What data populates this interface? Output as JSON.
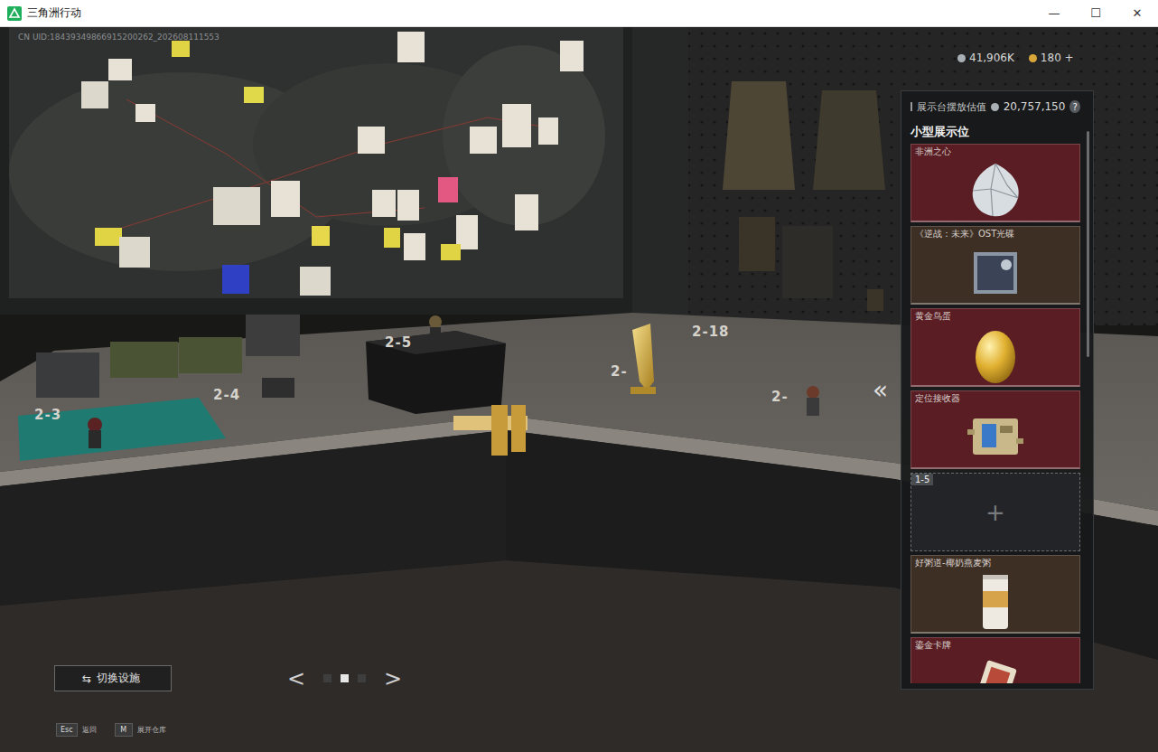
{
  "window": {
    "title": "三角洲行动",
    "controls": [
      "—",
      "☐",
      "✕"
    ]
  },
  "uid": "CN UID:18439349866915200262_202608111553",
  "currencies": [
    {
      "amount": "41,906K",
      "color": "#a9b0b5"
    },
    {
      "amount": "180 +",
      "color": "#d9a63a"
    }
  ],
  "desk_labels": [
    "2-3",
    "2-4",
    "2-5",
    "2-18",
    "2-",
    "2-"
  ],
  "display_panel": {
    "title": "展示台摆放估值",
    "value": "20,757,150",
    "help": "?",
    "section": "小型展示位",
    "slots": [
      {
        "kind": "item",
        "name": "非洲之心",
        "color": "#5a1d23"
      },
      {
        "kind": "item",
        "name": "《逆战：未来》OST光碟",
        "color": "#3d2f24"
      },
      {
        "kind": "item",
        "name": "黄金鸟蛋",
        "color": "#5a1d23"
      },
      {
        "kind": "item",
        "name": "定位接收器",
        "color": "#5a1d23"
      },
      {
        "kind": "empty",
        "name": "1-5",
        "plus": "+",
        "color": "#232427"
      },
      {
        "kind": "item",
        "name": "好粥道-椰奶燕麦粥",
        "color": "#3d2f24"
      },
      {
        "kind": "item",
        "name": "鎏金卡牌",
        "color": "#5a1d23"
      }
    ]
  },
  "collapse": "«",
  "facility_button": {
    "icon": "⇆",
    "label": "切换设施"
  },
  "pager": {
    "prev": "<",
    "next": ">",
    "pages": [
      {
        "selected": false
      },
      {
        "selected": true
      },
      {
        "selected": false
      }
    ]
  },
  "hints": [
    {
      "key": "Esc",
      "label": "返回"
    },
    {
      "key": "M",
      "label": "展开仓库"
    }
  ]
}
